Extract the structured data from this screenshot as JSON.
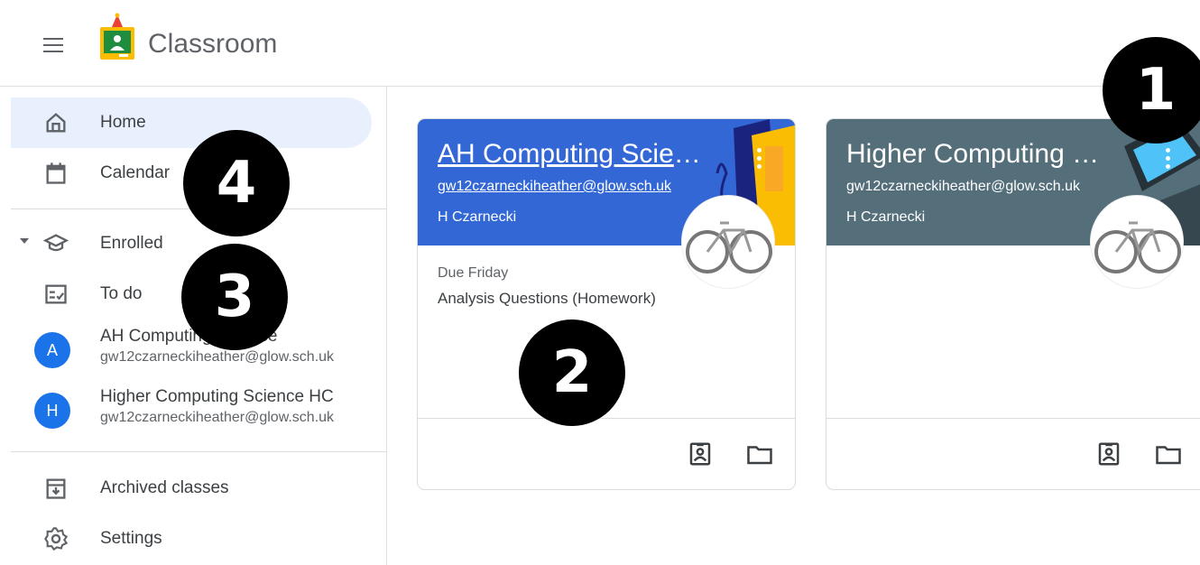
{
  "header": {
    "app_title": "Classroom",
    "menu_icon": "hamburger-menu-icon",
    "logo_icon": "classroom-logo-icon"
  },
  "sidebar": {
    "primary": [
      {
        "label": "Home",
        "icon": "home-icon",
        "active": true
      },
      {
        "label": "Calendar",
        "icon": "calendar-icon"
      }
    ],
    "enrolled": {
      "label": "Enrolled",
      "icon": "enrolled-hat-icon"
    },
    "todo": {
      "label": "To do",
      "icon": "todo-checklist-icon"
    },
    "classes": [
      {
        "initial": "A",
        "name": "AH Computing Science",
        "email": "gw12czarneckiheather@glow.sch.uk"
      },
      {
        "initial": "H",
        "name": "Higher Computing Science HC",
        "email": "gw12czarneckiheather@glow.sch.uk"
      }
    ],
    "archived": {
      "label": "Archived classes",
      "icon": "archive-icon"
    },
    "settings": {
      "label": "Settings",
      "icon": "gear-icon"
    }
  },
  "cards": [
    {
      "title": "AH Computing Scien...",
      "email": "gw12czarneckiheather@glow.sch.uk",
      "teacher": "H Czarnecki",
      "due": "Due Friday",
      "assignment": "Analysis Questions (Homework)",
      "header_color": "#3367d6"
    },
    {
      "title": "Higher Computing Sc...",
      "email": "gw12czarneckiheather@glow.sch.uk",
      "teacher": "H Czarnecki",
      "header_color": "#546e7a"
    }
  ],
  "callouts": [
    "1",
    "2",
    "3",
    "4"
  ],
  "colors": {
    "accent": "#1a73e8",
    "active_bg": "#e8f0fe"
  }
}
